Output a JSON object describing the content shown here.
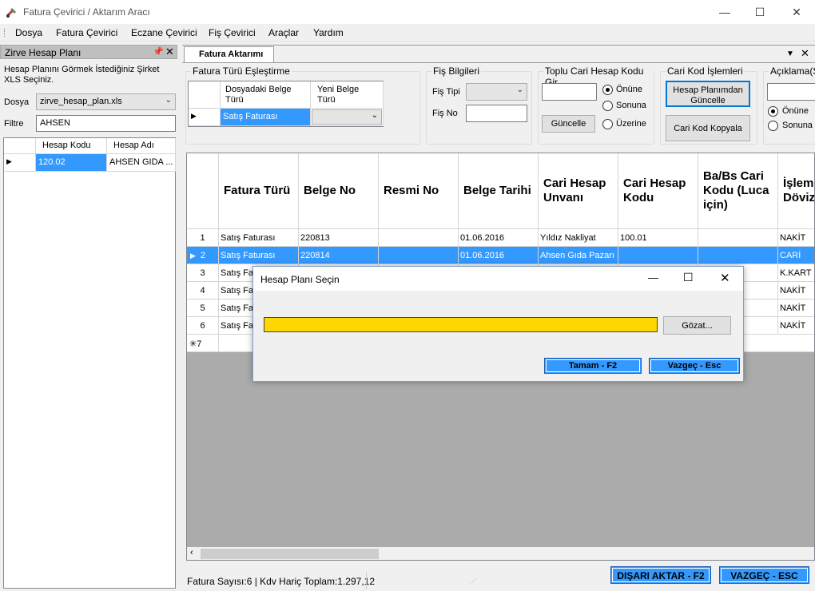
{
  "window": {
    "title": "Fatura Çevirici / Aktarım Aracı"
  },
  "menu": [
    "Dosya",
    "Fatura Çevirici",
    "Eczane Çevirici",
    "Fiş Çevirici",
    "Araçlar",
    "Yardım"
  ],
  "left_panel": {
    "title": "Zirve Hesap Planı",
    "instruction": "Hesap Planını Görmek İstediğiniz Şirket XLS Seçiniz.",
    "dosya_label": "Dosya",
    "dosya_value": "zirve_hesap_plan.xls",
    "filtre_label": "Filtre",
    "filtre_value": "AHSEN",
    "grid": {
      "columns": [
        "Hesap Kodu",
        "Hesap Adı"
      ],
      "rows": [
        [
          "120.02",
          "AHSEN GIDA ..."
        ]
      ]
    }
  },
  "doc_tab": {
    "label": "Fatura Aktarımı"
  },
  "groups": {
    "fatura_turu": {
      "title": "Fatura Türü Eşleştirme",
      "col1": "Dosyadaki Belge Türü",
      "col2": "Yeni Belge Türü",
      "row_value": "Satış Faturası"
    },
    "fis_bilgileri": {
      "title": "Fiş Bilgileri",
      "fis_tipi_label": "Fiş Tipi",
      "fis_no_label": "Fiş No"
    },
    "toplu_cari": {
      "title": "Toplu Cari Hesap Kodu Gir",
      "button": "Güncelle",
      "radios": [
        "Önüne",
        "Sonuna",
        "Üzerine"
      ],
      "selected": "Önüne"
    },
    "cari_kod": {
      "title": "Cari Kod İşlemleri",
      "btn1": "Hesap Planımdan Güncelle",
      "btn2": "Cari Kod Kopyala"
    },
    "aciklama": {
      "title": "Açıklama(Sa",
      "radios": [
        "Önüne",
        "Sonuna"
      ],
      "selected": "Önüne"
    }
  },
  "main_grid": {
    "columns": [
      "Fatura Türü",
      "Belge No",
      "Resmi No",
      "Belge Tarihi",
      "Cari Hesap Unvanı",
      "Cari Hesap Kodu",
      "Ba/Bs Cari Kodu (Luca için)",
      "İşlem Dövizi"
    ],
    "rows": [
      {
        "num": "1",
        "cells": [
          "Satış Faturası",
          "220813",
          "",
          "01.06.2016",
          "Yıldız Nakliyat",
          "100.01",
          "",
          "NAKİT"
        ]
      },
      {
        "num": "2",
        "cells": [
          "Satış Faturası",
          "220814",
          "",
          "01.06.2016",
          "Ahsen Gıda Pazarı",
          "",
          "",
          "CARİ"
        ]
      },
      {
        "num": "3",
        "cells": [
          "Satış Fat",
          "",
          "",
          "",
          "",
          "",
          "",
          "K.KART"
        ]
      },
      {
        "num": "4",
        "cells": [
          "Satış Fat",
          "",
          "",
          "",
          "",
          "",
          "",
          "NAKİT"
        ]
      },
      {
        "num": "5",
        "cells": [
          "Satış Fat",
          "",
          "",
          "",
          "",
          "",
          "",
          "NAKİT"
        ]
      },
      {
        "num": "6",
        "cells": [
          "Satış Fat",
          "",
          "",
          "",
          "",
          "",
          "",
          "NAKİT"
        ]
      }
    ],
    "new_row": "7",
    "selected_row": 2
  },
  "dialog": {
    "title": "Hesap Planı Seçin",
    "browse": "Gözat...",
    "ok": "Tamam - F2",
    "cancel": "Vazgeç - Esc",
    "accent": "#ffd700"
  },
  "status": {
    "text": "Fatura Sayısı:6 | Kdv Hariç Toplam:1.297,12"
  },
  "bottom_buttons": {
    "export": "DIŞARI AKTAR - F2",
    "cancel": "VAZGEÇ - ESC"
  },
  "colors": {
    "selection": "#3399ff"
  }
}
